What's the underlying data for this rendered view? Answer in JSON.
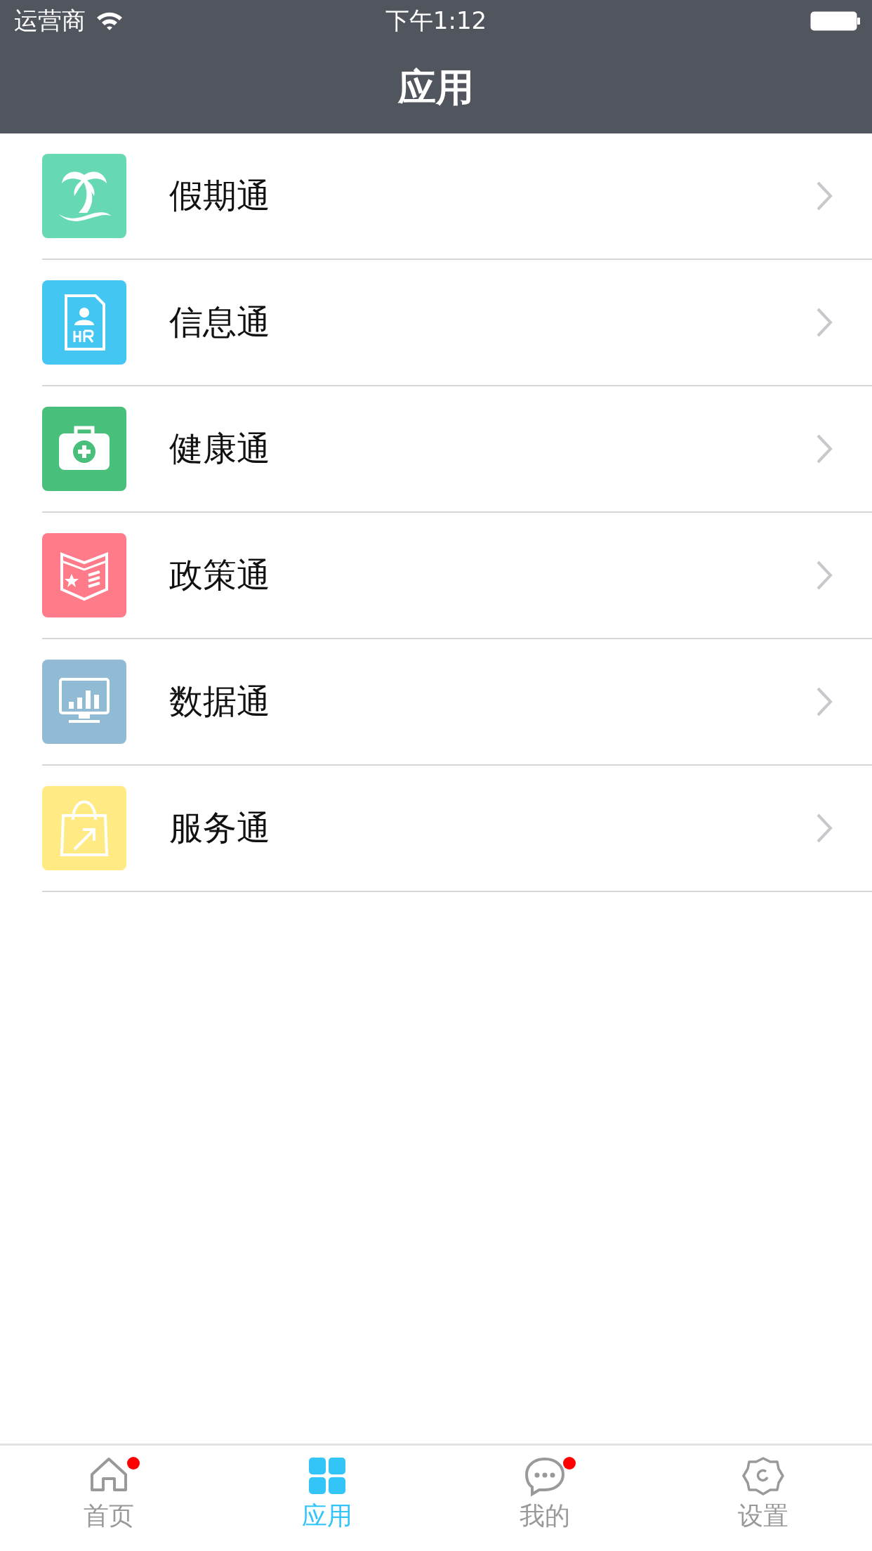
{
  "status_bar": {
    "carrier": "运营商",
    "time": "下午1:12"
  },
  "nav_bar": {
    "title": "应用"
  },
  "items": [
    {
      "label": "假期通",
      "kind": "palm",
      "color": "#66d9b4"
    },
    {
      "label": "信息通",
      "kind": "hr",
      "color": "#44c6f2"
    },
    {
      "label": "健康通",
      "kind": "medkit",
      "color": "#48bf7a"
    },
    {
      "label": "政策通",
      "kind": "book",
      "color": "#ff7b8a"
    },
    {
      "label": "数据通",
      "kind": "monitor",
      "color": "#91bbd5"
    },
    {
      "label": "服务通",
      "kind": "bag",
      "color": "#ffea84"
    }
  ],
  "tabs": [
    {
      "label": "首页",
      "kind": "home",
      "selected": false,
      "badge": true
    },
    {
      "label": "应用",
      "kind": "grid",
      "selected": true,
      "badge": false
    },
    {
      "label": "我的",
      "kind": "chat",
      "selected": false,
      "badge": true
    },
    {
      "label": "设置",
      "kind": "gear",
      "selected": false,
      "badge": false
    }
  ]
}
